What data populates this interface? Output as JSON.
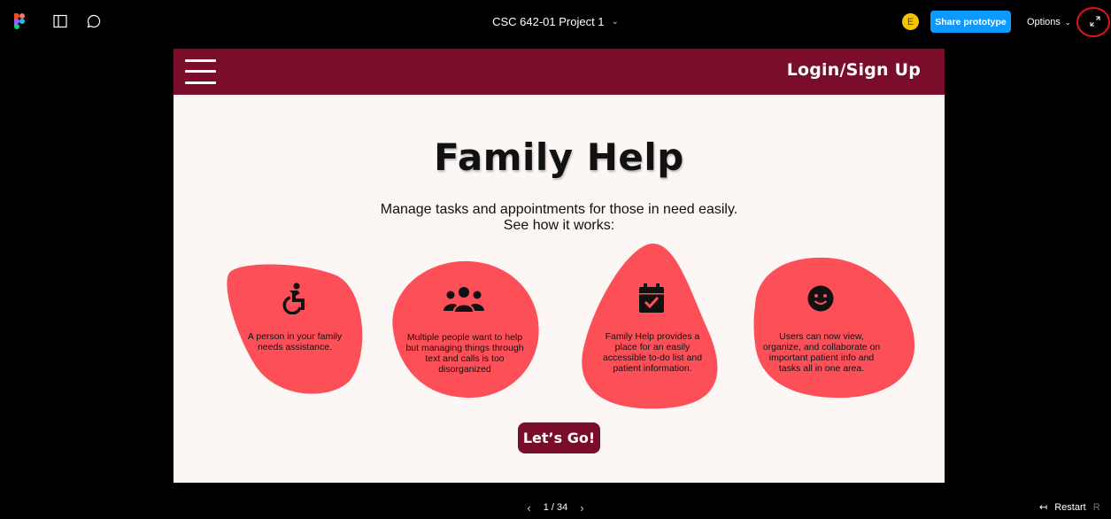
{
  "viewer": {
    "title": "CSC 642-01 Project 1",
    "avatar_letter": "E",
    "share_label": "Share prototype",
    "options_label": "Options",
    "page_indicator": "1 / 34",
    "restart_label": "Restart",
    "restart_shortcut": "R",
    "accent_color": "#0d99ff"
  },
  "app": {
    "login_label": "Login/Sign Up",
    "title": "Family Help",
    "subtitle_line1": "Manage tasks and appointments for those in need easily.",
    "subtitle_line2": "See how it works:",
    "cta_label": "Let’s Go!",
    "brand_color": "#7a0d29",
    "blob_color": "#fd4f58",
    "cards": [
      {
        "icon": "wheelchair-icon",
        "text": "A person in your family needs assistance."
      },
      {
        "icon": "users-icon",
        "text": "Multiple people want to help but managing things through text and calls is too disorganized"
      },
      {
        "icon": "calendar-check-icon",
        "text": "Family Help provides a place for an easily accessible to-do list and patient information."
      },
      {
        "icon": "smile-icon",
        "text": "Users can now view, organize, and collaborate on important patient info and tasks all in one area."
      }
    ]
  }
}
